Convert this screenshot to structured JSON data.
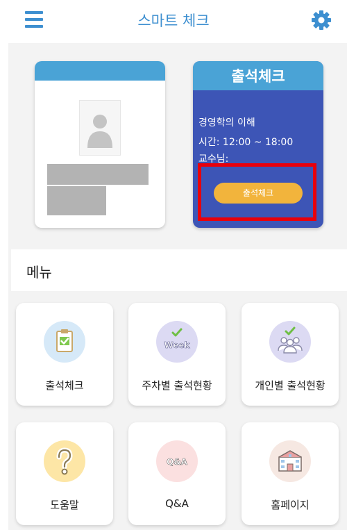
{
  "header": {
    "title": "스마트 체크",
    "menu_icon": "hamburger-menu-icon",
    "settings_icon": "gear-icon",
    "accent_color": "#3d8fd0"
  },
  "id_card": {
    "header_color": "#4aa3d6",
    "photo_icon": "person-placeholder-icon"
  },
  "attendance_card": {
    "title": "출석체크",
    "course": "경영학의 이해",
    "time": "시간: 12:00 ~ 18:00",
    "professor": "교수님:",
    "button_label": "출석체크",
    "background_color": "#3d55b6",
    "button_color": "#f2b43c",
    "highlight_color": "#e8000b"
  },
  "menu": {
    "title": "메뉴",
    "items": [
      {
        "label": "출석체크",
        "icon": "clipboard-check-icon"
      },
      {
        "label": "주차별 출석현황",
        "icon": "week-icon",
        "icon_text": "Week"
      },
      {
        "label": "개인별 출석현황",
        "icon": "people-check-icon"
      },
      {
        "label": "도움말",
        "icon": "question-icon"
      },
      {
        "label": "Q&A",
        "icon": "qna-icon",
        "icon_text": "Q&A"
      },
      {
        "label": "홈페이지",
        "icon": "school-building-icon"
      }
    ]
  }
}
